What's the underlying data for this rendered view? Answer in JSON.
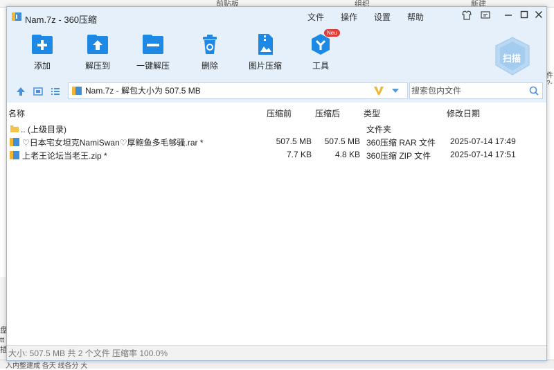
{
  "background": {
    "tabs": [
      "前贴板",
      "组织",
      "新建"
    ],
    "left_fragments": [
      "盘",
      "tt",
      "插"
    ],
    "bottom_text": "入内整建成 各天 线各分 大",
    "right_fragments": [
      "件",
      "?-"
    ]
  },
  "window": {
    "title": "Nam.7z - 360压缩",
    "menu": [
      "文件",
      "操作",
      "设置",
      "帮助"
    ]
  },
  "toolbar": {
    "add": "添加",
    "extract_to": "解压到",
    "one_click_extract": "一键解压",
    "delete": "删除",
    "image_compress": "图片压缩",
    "tools": "工具",
    "tools_badge": "Neu",
    "scan": "扫描"
  },
  "address": {
    "path": "Nam.7z - 解包大小为 507.5 MB",
    "search_placeholder": "搜索包内文件"
  },
  "columns": {
    "name": "名称",
    "original": "压缩前",
    "compressed": "压缩后",
    "type": "类型",
    "modified": "修改日期"
  },
  "rows": [
    {
      "name": ".. (上级目录)",
      "original": "",
      "compressed": "",
      "type": "文件夹",
      "modified": ""
    },
    {
      "name": "♡日本宅女坦克NamiSwan♡厚鲍鱼多毛够骚.rar *",
      "original": "507.5 MB",
      "compressed": "507.5 MB",
      "type": "360压缩 RAR 文件",
      "modified": "2025-07-14 17:49"
    },
    {
      "name": "上老王论坛当老王.zip *",
      "original": "7.7 KB",
      "compressed": "4.8 KB",
      "type": "360压缩 ZIP 文件",
      "modified": "2025-07-14 17:51"
    }
  ],
  "status": "大小: 507.5 MB 共 2 个文件 压缩率 100.0%",
  "colors": {
    "accent": "#1e88e5",
    "titlebar_bg": "#e6f0fb",
    "badge": "#e53935"
  }
}
